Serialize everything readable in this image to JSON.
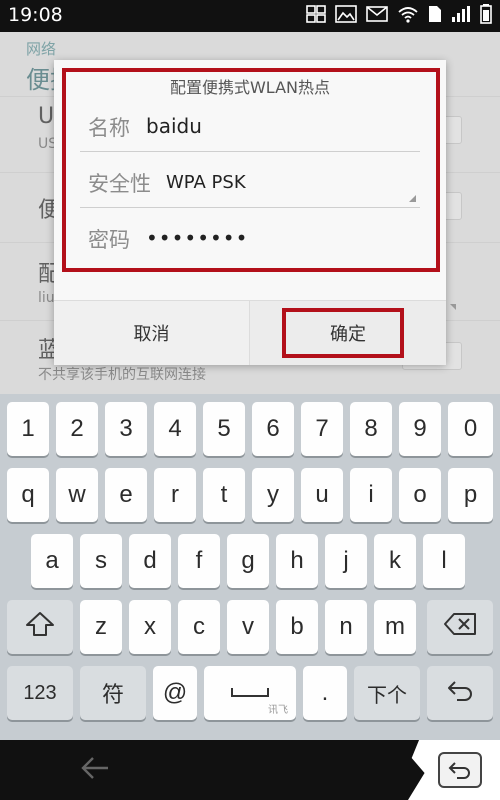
{
  "status_bar": {
    "time": "19:08",
    "icons": [
      "screenshot-icon",
      "gallery-icon",
      "mail-icon",
      "wifi-icon",
      "sim-icon",
      "signal-icon",
      "battery-icon"
    ]
  },
  "settings": {
    "back_label": "网络",
    "title": "便携",
    "rows": [
      {
        "title": "U",
        "subtitle": "US"
      },
      {
        "title": "便",
        "subtitle": ""
      },
      {
        "title": "配",
        "subtitle": "liu"
      },
      {
        "title": "蓝",
        "subtitle": "不共享该手机的互联网连接"
      }
    ]
  },
  "dialog": {
    "title": "配置便携式WLAN热点",
    "name_label": "名称",
    "name_value": "baidu",
    "security_label": "安全性",
    "security_value": "WPA PSK",
    "password_label": "密码",
    "password_value": "••••••••",
    "cancel_label": "取消",
    "ok_label": "确定",
    "highlight_color": "#b3101a"
  },
  "keyboard": {
    "row1": [
      "1",
      "2",
      "3",
      "4",
      "5",
      "6",
      "7",
      "8",
      "9",
      "0"
    ],
    "row2": [
      "q",
      "w",
      "e",
      "r",
      "t",
      "y",
      "u",
      "i",
      "o",
      "p"
    ],
    "row3": [
      "a",
      "s",
      "d",
      "f",
      "g",
      "h",
      "j",
      "k",
      "l"
    ],
    "row4": [
      "z",
      "x",
      "c",
      "v",
      "b",
      "n",
      "m"
    ],
    "shift_icon": "shift-icon",
    "delete_icon": "backspace-icon",
    "num_label": "123",
    "symbol_label": "符",
    "at_label": "@",
    "space_brand": "讯飞",
    "dot_label": ".",
    "next_label": "下个",
    "enter_icon": "return-icon"
  },
  "navbar": {
    "back_icon": "back-arrow-icon",
    "return_icon": "return-icon"
  }
}
